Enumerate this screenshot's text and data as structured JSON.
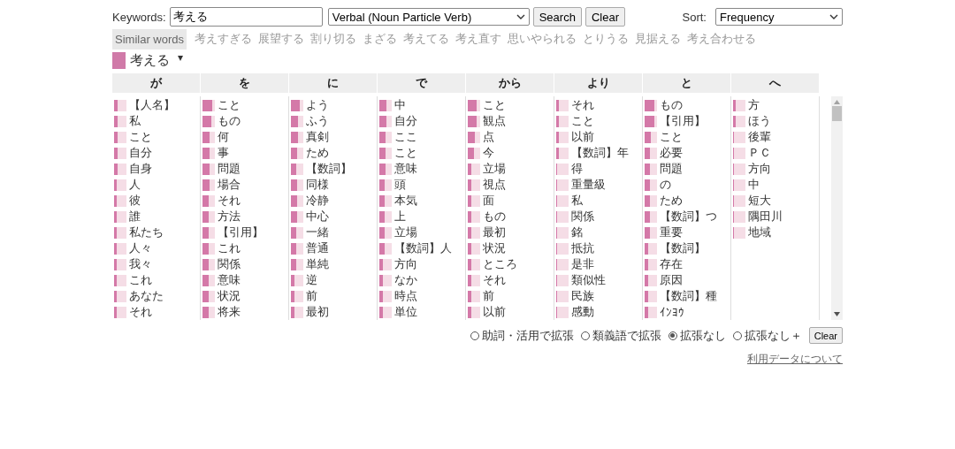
{
  "search": {
    "label": "Keywords:",
    "value": "考える",
    "mode": "Verbal (Noun Particle Verb)",
    "search_button": "Search",
    "clear_button": "Clear",
    "sort_label": "Sort:",
    "sort": "Frequency"
  },
  "similar": {
    "label": "Similar words",
    "words": [
      "考えすぎる",
      "展望する",
      "割り切る",
      "まざる",
      "考えてる",
      "考え直す",
      "思いやられる",
      "とりうる",
      "見据える",
      "考え合わせる"
    ]
  },
  "current": {
    "word": "考える",
    "caret": "▾"
  },
  "columns": [
    {
      "header": "が",
      "items": [
        {
          "text": "【人名】",
          "level": 0.3
        },
        {
          "text": "私",
          "level": 0.25
        },
        {
          "text": "こと",
          "level": 0.3
        },
        {
          "text": "自分",
          "level": 0.25
        },
        {
          "text": "自身",
          "level": 0.25
        },
        {
          "text": "人",
          "level": 0.2
        },
        {
          "text": "彼",
          "level": 0.2
        },
        {
          "text": "誰",
          "level": 0.2
        },
        {
          "text": "私たち",
          "level": 0.2
        },
        {
          "text": "人々",
          "level": 0.2
        },
        {
          "text": "我々",
          "level": 0.2
        },
        {
          "text": "これ",
          "level": 0.2
        },
        {
          "text": "あなた",
          "level": 0.2
        },
        {
          "text": "それ",
          "level": 0.2
        }
      ]
    },
    {
      "header": "を",
      "items": [
        {
          "text": "こと",
          "level": 0.8
        },
        {
          "text": "もの",
          "level": 0.7
        },
        {
          "text": "何",
          "level": 0.6
        },
        {
          "text": "事",
          "level": 0.6
        },
        {
          "text": "問題",
          "level": 0.6
        },
        {
          "text": "場合",
          "level": 0.6
        },
        {
          "text": "それ",
          "level": 0.5
        },
        {
          "text": "方法",
          "level": 0.5
        },
        {
          "text": "【引用】",
          "level": 0.5
        },
        {
          "text": "これ",
          "level": 0.5
        },
        {
          "text": "関係",
          "level": 0.5
        },
        {
          "text": "意味",
          "level": 0.5
        },
        {
          "text": "状況",
          "level": 0.5
        },
        {
          "text": "将来",
          "level": 0.5
        }
      ]
    },
    {
      "header": "に",
      "items": [
        {
          "text": "よう",
          "level": 0.7
        },
        {
          "text": "ふう",
          "level": 0.6
        },
        {
          "text": "真剣",
          "level": 0.6
        },
        {
          "text": "ため",
          "level": 0.5
        },
        {
          "text": "【数詞】",
          "level": 0.4
        },
        {
          "text": "同様",
          "level": 0.5
        },
        {
          "text": "冷静",
          "level": 0.5
        },
        {
          "text": "中心",
          "level": 0.5
        },
        {
          "text": "一緒",
          "level": 0.4
        },
        {
          "text": "普通",
          "level": 0.4
        },
        {
          "text": "単純",
          "level": 0.4
        },
        {
          "text": "逆",
          "level": 0.3
        },
        {
          "text": "前",
          "level": 0.3
        },
        {
          "text": "最初",
          "level": 0.3
        }
      ]
    },
    {
      "header": "で",
      "items": [
        {
          "text": "中",
          "level": 0.6
        },
        {
          "text": "自分",
          "level": 0.6
        },
        {
          "text": "ここ",
          "level": 0.5
        },
        {
          "text": "こと",
          "level": 0.5
        },
        {
          "text": "意味",
          "level": 0.5
        },
        {
          "text": "頭",
          "level": 0.4
        },
        {
          "text": "本気",
          "level": 0.4
        },
        {
          "text": "上",
          "level": 0.4
        },
        {
          "text": "立場",
          "level": 0.4
        },
        {
          "text": "【数詞】人",
          "level": 0.4
        },
        {
          "text": "方向",
          "level": 0.3
        },
        {
          "text": "なか",
          "level": 0.3
        },
        {
          "text": "時点",
          "level": 0.3
        },
        {
          "text": "単位",
          "level": 0.3
        }
      ]
    },
    {
      "header": "から",
      "items": [
        {
          "text": "こと",
          "level": 0.7
        },
        {
          "text": "観点",
          "level": 0.7
        },
        {
          "text": "点",
          "level": 0.6
        },
        {
          "text": "今",
          "level": 0.5
        },
        {
          "text": "立場",
          "level": 0.3
        },
        {
          "text": "視点",
          "level": 0.3
        },
        {
          "text": "面",
          "level": 0.3
        },
        {
          "text": "もの",
          "level": 0.3
        },
        {
          "text": "最初",
          "level": 0.3
        },
        {
          "text": "状況",
          "level": 0.3
        },
        {
          "text": "ところ",
          "level": 0.3
        },
        {
          "text": "それ",
          "level": 0.3
        },
        {
          "text": "前",
          "level": 0.3
        },
        {
          "text": "以前",
          "level": 0.3
        }
      ]
    },
    {
      "header": "より",
      "items": [
        {
          "text": "それ",
          "level": 0.2
        },
        {
          "text": "こと",
          "level": 0.2
        },
        {
          "text": "以前",
          "level": 0.2
        },
        {
          "text": "【数詞】年",
          "level": 0.2
        },
        {
          "text": "得",
          "level": 0.05
        },
        {
          "text": "重量級",
          "level": 0.05
        },
        {
          "text": "私",
          "level": 0.05
        },
        {
          "text": "関係",
          "level": 0.05
        },
        {
          "text": "銘",
          "level": 0.05
        },
        {
          "text": "抵抗",
          "level": 0.05
        },
        {
          "text": "是非",
          "level": 0.05
        },
        {
          "text": "類似性",
          "level": 0.05
        },
        {
          "text": "民族",
          "level": 0.05
        },
        {
          "text": "感動",
          "level": 0.05
        }
      ]
    },
    {
      "header": "と",
      "items": [
        {
          "text": "もの",
          "level": 0.8
        },
        {
          "text": "【引用】",
          "level": 0.8
        },
        {
          "text": "こと",
          "level": 0.5
        },
        {
          "text": "必要",
          "level": 0.4
        },
        {
          "text": "問題",
          "level": 0.4
        },
        {
          "text": "の",
          "level": 0.4
        },
        {
          "text": "ため",
          "level": 0.4
        },
        {
          "text": "【数詞】つ",
          "level": 0.4
        },
        {
          "text": "重要",
          "level": 0.4
        },
        {
          "text": "【数詞】",
          "level": 0.3
        },
        {
          "text": "存在",
          "level": 0.3
        },
        {
          "text": "原因",
          "level": 0.3
        },
        {
          "text": "【数詞】種",
          "level": 0.3
        },
        {
          "text": "ｲﾝﾖｳ",
          "level": 0.3
        }
      ]
    },
    {
      "header": "へ",
      "items": [
        {
          "text": "方",
          "level": 0.2
        },
        {
          "text": "ほう",
          "level": 0.2
        },
        {
          "text": "後輩",
          "level": 0.05
        },
        {
          "text": "ＰＣ",
          "level": 0.05
        },
        {
          "text": "方向",
          "level": 0.05
        },
        {
          "text": "中",
          "level": 0.05
        },
        {
          "text": "短大",
          "level": 0.05
        },
        {
          "text": "隅田川",
          "level": 0.05
        },
        {
          "text": "地域",
          "level": 0.05
        }
      ]
    }
  ],
  "options": [
    {
      "label": "助詞・活用で拡張",
      "selected": false
    },
    {
      "label": "類義語で拡張",
      "selected": false
    },
    {
      "label": "拡張なし",
      "selected": true
    },
    {
      "label": "拡張なし＋",
      "selected": false
    }
  ],
  "options_clear": "Clear",
  "link": "利用データについて"
}
